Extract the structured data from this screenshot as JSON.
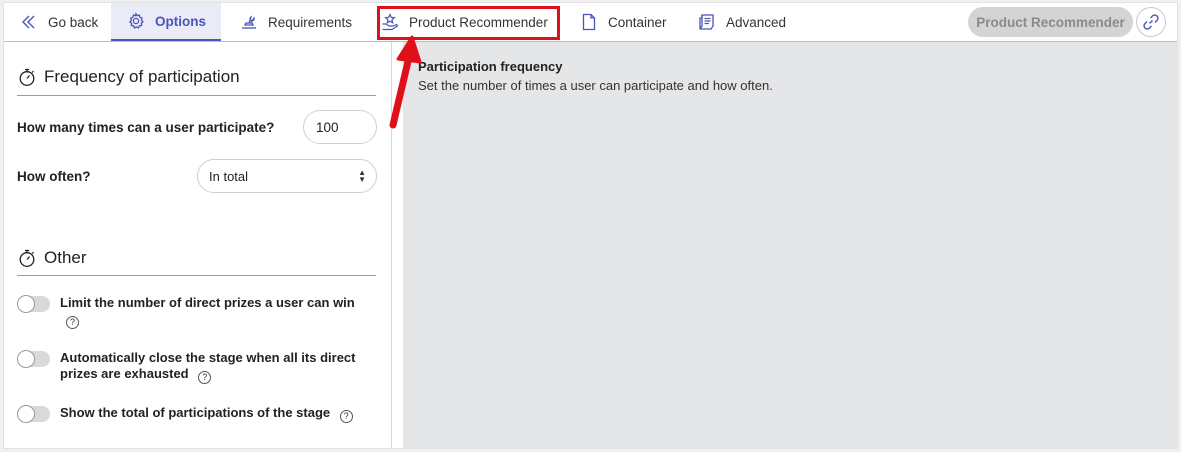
{
  "nav": {
    "go_back": "Go back",
    "tabs": [
      {
        "label": "Options",
        "icon": "gear-icon",
        "active": true
      },
      {
        "label": "Requirements",
        "icon": "seal-icon",
        "active": false
      },
      {
        "label": "Product Recommender",
        "icon": "star-hand-icon",
        "active": false
      },
      {
        "label": "Container",
        "icon": "document-icon",
        "active": false
      },
      {
        "label": "Advanced",
        "icon": "scroll-icon",
        "active": false
      }
    ],
    "product_recommender_button": "Product Recommender",
    "link_icon": "link-icon"
  },
  "frequency": {
    "title": "Frequency of participation",
    "times_label": "How many times can a user participate?",
    "times_value": "100",
    "often_label": "How often?",
    "often_value": "In total"
  },
  "other": {
    "title": "Other",
    "toggles": [
      {
        "label": "Limit the number of direct prizes a user can win",
        "on": false
      },
      {
        "label": "Automatically close the stage when all its direct prizes are exhausted",
        "on": false
      },
      {
        "label": "Show the total of participations of the stage",
        "on": false
      }
    ],
    "help_glyph": "?"
  },
  "help_panel": {
    "title": "Participation frequency",
    "description": "Set the number of times a user can participate and how often."
  },
  "colors": {
    "accent": "#4a55b8",
    "highlight": "#e0101a",
    "panel_bg": "#e5e6e8"
  }
}
